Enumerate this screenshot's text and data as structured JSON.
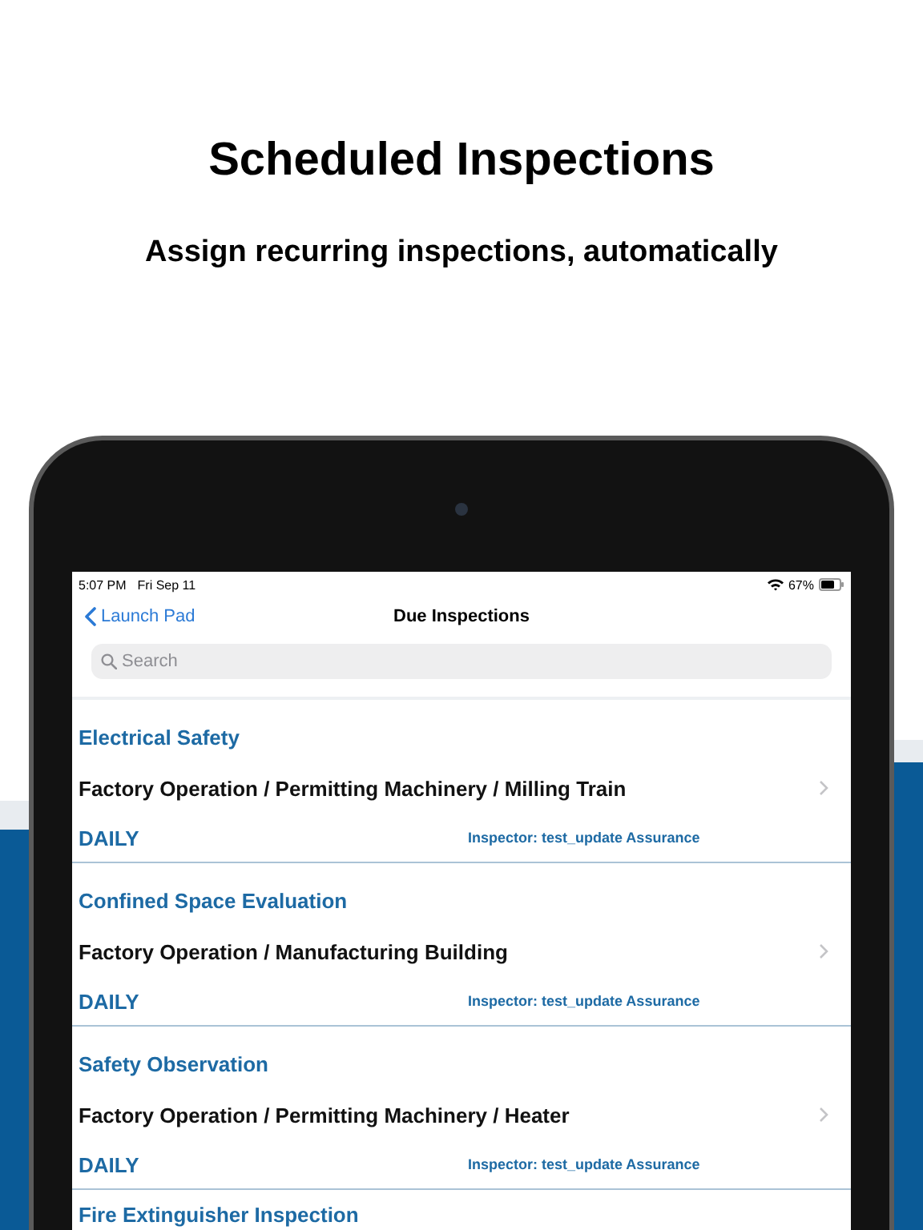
{
  "header": {
    "title": "Scheduled Inspections",
    "subtitle": "Assign recurring inspections, automatically"
  },
  "status_bar": {
    "time": "5:07 PM",
    "date": "Fri Sep 11",
    "battery": "67%"
  },
  "nav": {
    "back": "Launch Pad",
    "title": "Due Inspections"
  },
  "search": {
    "placeholder": "Search"
  },
  "inspections": [
    {
      "title": "Electrical Safety",
      "location": "Factory Operation / Permitting Machinery / Milling Train",
      "frequency": "DAILY",
      "inspector": "Inspector: test_update Assurance"
    },
    {
      "title": "Confined Space Evaluation",
      "location": "Factory Operation / Manufacturing Building",
      "frequency": "DAILY",
      "inspector": "Inspector: test_update Assurance"
    },
    {
      "title": "Safety Observation",
      "location": "Factory Operation / Permitting Machinery / Heater",
      "frequency": "DAILY",
      "inspector": "Inspector: test_update Assurance"
    },
    {
      "title": "Fire Extinguisher Inspection"
    }
  ]
}
